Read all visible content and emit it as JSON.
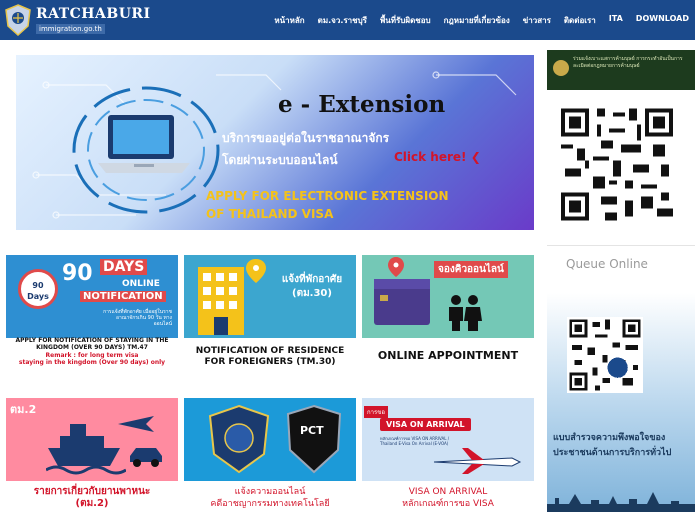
{
  "header": {
    "brand_title": "RATCHABURI",
    "brand_sub": "immigration.go.th",
    "nav": [
      "หน้าหลัก",
      "ตม.จว.ราชบุรี",
      "พื้นที่รับผิดชอบ",
      "กฎหมายที่เกี่ยวข้อง",
      "ข่าวสาร",
      "ติดต่อเรา",
      "ITA",
      "DOWNLOAD"
    ]
  },
  "banner": {
    "title": "e - Extension",
    "line1": "บริการขออยู่ต่อในราชอาณาจักร",
    "line2": "โดยผ่านระบบออนไลน์",
    "click": "Click here!",
    "apply_line1": "APPLY FOR ELECTRONIC EXTENSION",
    "apply_line2": "OF THAILAND VISA"
  },
  "sidebar": {
    "card1_text": "ร่วมแจ้งเบาะแสการค้ามนุษย์ การกระทำอันเป็นการละเมิดต่อกฎหมายการค้ามนุษย์",
    "queue_label": "Queue Online",
    "survey_text": "แบบสำรวจความพึงพอใจของประชาชนด้านการบริการทั่วไป"
  },
  "tiles": {
    "t1": {
      "circle": "90 Days",
      "num": "90",
      "days": "DAYS",
      "online": "ONLINE",
      "notification": "NOTIFICATION",
      "small": "การแจ้งที่พักอาศัย เมื่ออยู่ในราชอาณาจักรเกิน 90 วัน ทางออนไลน์",
      "caption": "APPLY FOR NOTIFICATION OF STAYING IN THE KINGDOM (OVER 90 DAYS) TM.47",
      "remark1": "Remark : for long term visa",
      "remark2": "staying in the kingdom (Over 90 days) only"
    },
    "t2": {
      "label": "แจ้งที่พักอาศัย (ตม.30)",
      "caption": "NOTIFICATION OF RESIDENCE FOR FOREIGNERS (TM.30)"
    },
    "t3": {
      "label": "จองคิวออนไลน์",
      "caption": "ONLINE APPOINTMENT"
    },
    "t4": {
      "badge": "ตม.2",
      "caption1": "รายการเกี่ยวกับยานพาหนะ",
      "caption2": "(ตม.2)"
    },
    "t5": {
      "police_text": "PCT",
      "caption1": "แจ้งความออนไลน์",
      "caption2": "คดีอาชญากรรมทางเทคโนโลยี"
    },
    "t6": {
      "tag": "การขอ",
      "banner": "VISA ON ARRIVAL",
      "small": "หลักเกณฑ์การขอ VISA ON ARRIVAL / Thailand E-Visa On Arrival (E-VOA)",
      "caption1": "VISA ON ARRIVAL",
      "caption2": "หลักเกณฑ์การขอ VISA"
    }
  },
  "colors": {
    "header_bg": "#1b4a8c",
    "accent_red": "#d2142a",
    "accent_yellow": "#f4c21a"
  }
}
